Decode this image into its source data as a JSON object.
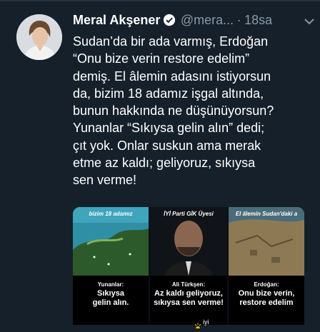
{
  "tweet": {
    "author_name": "Meral Akşener",
    "handle": "@mera...",
    "separator": "·",
    "time": "18sa",
    "text": "Sudan’da bir ada varmış, Erdoğan\n“Onu bize verin restore edelim”\ndemiş. El âlemin adasını istiyorsun\nda, bizim 18 adamız işgal altında,\nbunun hakkında ne düşünüyorsun?\nYunanlar “Sıkıysa gelin alın” dedi;\nçıt yok. Onlar suskun ama merak\netme az kaldı; geliyoruz, sıkıysa\nsen verme!"
  },
  "media": {
    "panels": [
      {
        "top_caption": "bizim 18 adamız",
        "speaker": "Yunanlar:",
        "quote": "Sıkıysa\ngelin alın."
      },
      {
        "top_caption": "İYİ Parti GİK Üyesi",
        "speaker": "Ali Türkşen:",
        "quote": "Az kaldı geliyoruz,\nsıkıysa sen verme!"
      },
      {
        "top_caption": "El âlemin Sudan'daki a",
        "speaker": "Erdoğan:",
        "quote": "Onu bize verin,\nrestore edelim"
      }
    ],
    "logo_text": "iyi"
  },
  "colors": {
    "background": "#15202b",
    "text": "#ffffff",
    "secondary": "#8899a6",
    "verified": "#ffffff"
  }
}
